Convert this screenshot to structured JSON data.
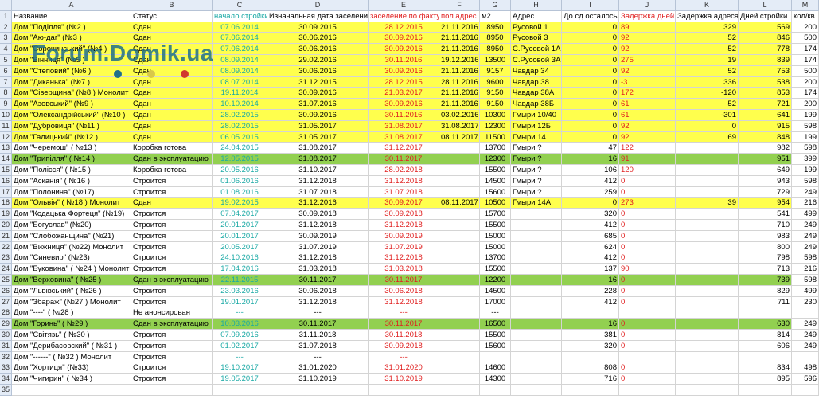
{
  "column_letters": [
    "A",
    "B",
    "C",
    "D",
    "E",
    "F",
    "G",
    "H",
    "I",
    "J",
    "K",
    "L",
    "M"
  ],
  "header": [
    "Название",
    "Статус",
    "начало стройки",
    "Изначальная дата заселения",
    "заселение по факту",
    "пол.адрес",
    "м2",
    "Адрес",
    "До сд.осталось",
    "Задержка дней",
    "Задержка адреса",
    "Дней стройки",
    "кол/кв"
  ],
  "watermark": "Forum.Domik.ua",
  "colors": {
    "yellow": "#ffff4d",
    "green": "#92d050",
    "teal": "#1aa9a5",
    "red": "#e02020"
  },
  "rows": [
    {
      "n": "2",
      "hl": "yellow",
      "c": [
        "Дом \"Поділля\" (№2 )",
        "Сдан",
        "07.06.2014",
        "30.09.2015",
        "28.12.2015",
        "21.11.2016",
        "8950",
        "Русовой 1",
        "0",
        "89",
        "329",
        "569",
        "200"
      ]
    },
    {
      "n": "3",
      "hl": "yellow",
      "c": [
        "Дом \"Аю-даг\" (№3 )",
        "Сдан",
        "07.06.2014",
        "30.06.2016",
        "30.09.2016",
        "21.11.2016",
        "8950",
        "Русовой 3",
        "0",
        "92",
        "52",
        "846",
        "500"
      ]
    },
    {
      "n": "4",
      "hl": "yellow",
      "c": [
        "Дом \"Сорочинський\" (№4 )",
        "Сдан",
        "07.06.2014",
        "30.06.2016",
        "30.09.2016",
        "21.11.2016",
        "8950",
        "С.Русовой 1А",
        "0",
        "92",
        "52",
        "778",
        "174"
      ]
    },
    {
      "n": "5",
      "hl": "yellow",
      "c": [
        "Дом \"Вінниця\" (№5 )",
        "Сдан",
        "08.09.2014",
        "29.02.2016",
        "30.11.2016",
        "19.12.2016",
        "13500",
        "С.Русовой 3А",
        "0",
        "275",
        "19",
        "839",
        "174"
      ]
    },
    {
      "n": "6",
      "hl": "yellow",
      "c": [
        "Дом \"Степовий\" (№6 )",
        "Сдан",
        "08.09.2014",
        "30.06.2016",
        "30.09.2016",
        "21.11.2016",
        "9157",
        "Чавдар 34",
        "0",
        "92",
        "52",
        "753",
        "500"
      ]
    },
    {
      "n": "7",
      "hl": "yellow",
      "c": [
        "Дом \"Диканька\" (№7 )",
        "Сдан",
        "08.07.2014",
        "31.12.2015",
        "28.12.2015",
        "28.11.2016",
        "9600",
        "Чавдар 38",
        "0",
        "-3",
        "336",
        "538",
        "200"
      ]
    },
    {
      "n": "8",
      "hl": "yellow",
      "c": [
        "Дом \"Сіверщина\" (№8 ) Монолит",
        "Сдан",
        "19.11.2014",
        "30.09.2016",
        "21.03.2017",
        "21.11.2016",
        "9150",
        "Чавдар 38А",
        "0",
        "172",
        "-120",
        "853",
        "174"
      ]
    },
    {
      "n": "9",
      "hl": "yellow",
      "c": [
        "Дом \"Азовський\" (№9 )",
        "Сдан",
        "10.10.2014",
        "31.07.2016",
        "30.09.2016",
        "21.11.2016",
        "9150",
        "Чавдар 38Б",
        "0",
        "61",
        "52",
        "721",
        "200"
      ]
    },
    {
      "n": "10",
      "hl": "yellow",
      "c": [
        "Дом \"Олександрійський\" (№10 )",
        "Сдан",
        "28.02.2015",
        "30.09.2016",
        "30.11.2016",
        "03.02.2016",
        "10300",
        "Гмыри 10/40",
        "0",
        "61",
        "-301",
        "641",
        "199"
      ]
    },
    {
      "n": "11",
      "hl": "yellow",
      "c": [
        "Дом \"Дубровиця\" (№11 )",
        "Сдан",
        "28.02.2015",
        "31.05.2017",
        "31.08.2017",
        "31.08.2017",
        "12300",
        "Гмыри 12Б",
        "0",
        "92",
        "0",
        "915",
        "598"
      ]
    },
    {
      "n": "12",
      "hl": "yellow",
      "c": [
        "Дом \"Галицький\" (№12 )",
        "Сдан",
        "06.05.2015",
        "31.05.2017",
        "31.08.2017",
        "08.11.2017",
        "11500",
        "Гмыри 14",
        "0",
        "92",
        "69",
        "848",
        "199"
      ]
    },
    {
      "n": "13",
      "hl": "",
      "c": [
        "Дом \"Черемош\" ( №13 )",
        "Коробка готова",
        "24.04.2015",
        "31.08.2017",
        "31.12.2017",
        "",
        "13700",
        "Гмыри ?",
        "47",
        "122",
        "",
        "982",
        "598"
      ]
    },
    {
      "n": "14",
      "hl": "green",
      "c": [
        "Дом \"Трипілля\" ( №14 )",
        "Сдан в эксплуатацию",
        "12.05.2015",
        "31.08.2017",
        "30.11.2017",
        "",
        "12300",
        "Гмыри ?",
        "16",
        "91",
        "",
        "951",
        "399"
      ]
    },
    {
      "n": "15",
      "hl": "",
      "c": [
        "Дом \"Полісся\" ( №15 )",
        "Коробка готова",
        "20.05.2016",
        "31.10.2017",
        "28.02.2018",
        "",
        "15500",
        "Гмыри ?",
        "106",
        "120",
        "",
        "649",
        "199"
      ]
    },
    {
      "n": "16",
      "hl": "",
      "c": [
        "Дом \"Асканія\" ( №16 )",
        "Строится",
        "01.06.2016",
        "31.12.2018",
        "31.12.2018",
        "",
        "14500",
        "Гмыри ?",
        "412",
        "0",
        "",
        "943",
        "598"
      ]
    },
    {
      "n": "17",
      "hl": "",
      "c": [
        "Дом \"Полонина\" (№17)",
        "Строится",
        "01.08.2016",
        "31.07.2018",
        "31.07.2018",
        "",
        "15600",
        "Гмыри ?",
        "259",
        "0",
        "",
        "729",
        "249"
      ]
    },
    {
      "n": "18",
      "hl": "yellow",
      "c": [
        "Дом \"Ольвія\" ( №18 ) Монолит",
        "Сдан",
        "19.02.2015",
        "31.12.2016",
        "30.09.2017",
        "08.11.2017",
        "10500",
        "Гмыри 14А",
        "0",
        "273",
        "39",
        "954",
        "216"
      ]
    },
    {
      "n": "19",
      "hl": "",
      "c": [
        "Дом \"Кодацька Фортеця\" (№19)",
        "Строится",
        "07.04.2017",
        "30.09.2018",
        "30.09.2018",
        "",
        "15700",
        "",
        "320",
        "0",
        "",
        "541",
        "499"
      ]
    },
    {
      "n": "20",
      "hl": "",
      "c": [
        "Дом \"Богуслав\" (№20)",
        "Строится",
        "20.01.2017",
        "31.12.2018",
        "31.12.2018",
        "",
        "15500",
        "",
        "412",
        "0",
        "",
        "710",
        "249"
      ]
    },
    {
      "n": "21",
      "hl": "",
      "c": [
        "Дом \"Слобожанщина\" (№21)",
        "Строится",
        "20.01.2017",
        "30.09.2019",
        "30.09.2019",
        "",
        "15000",
        "",
        "685",
        "0",
        "",
        "983",
        "249"
      ]
    },
    {
      "n": "22",
      "hl": "",
      "c": [
        "Дом \"Вижниця\" (№22) Монолит",
        "Строится",
        "20.05.2017",
        "31.07.2019",
        "31.07.2019",
        "",
        "15000",
        "",
        "624",
        "0",
        "",
        "800",
        "249"
      ]
    },
    {
      "n": "23",
      "hl": "",
      "c": [
        "Дом \"Синевир\" (№23)",
        "Строится",
        "24.10.2016",
        "31.12.2018",
        "31.12.2018",
        "",
        "13700",
        "",
        "412",
        "0",
        "",
        "798",
        "598"
      ]
    },
    {
      "n": "24",
      "hl": "",
      "c": [
        "Дом \"Буковина\" ( №24 ) Монолит",
        "Строится",
        "17.04.2016",
        "31.03.2018",
        "31.03.2018",
        "",
        "15500",
        "",
        "137",
        "90",
        "",
        "713",
        "216"
      ]
    },
    {
      "n": "25",
      "hl": "green",
      "c": [
        "Дом \"Верховина\" ( №25 )",
        "Сдан в эксплуатацию",
        "22.11.2015",
        "30.11.2017",
        "30.11.2017",
        "",
        "12200",
        "",
        "16",
        "0",
        "",
        "739",
        "598"
      ]
    },
    {
      "n": "26",
      "hl": "",
      "c": [
        "Дом \"Львівський\" ( №26 )",
        "Строится",
        "23.03.2016",
        "30.06.2018",
        "30.06.2018",
        "",
        "14500",
        "",
        "228",
        "0",
        "",
        "829",
        "499"
      ]
    },
    {
      "n": "27",
      "hl": "",
      "c": [
        "Дом \"Збараж\" (№27 ) Монолит",
        "Строится",
        "19.01.2017",
        "31.12.2018",
        "31.12.2018",
        "",
        "17000",
        "",
        "412",
        "0",
        "",
        "711",
        "230"
      ]
    },
    {
      "n": "28",
      "hl": "",
      "c": [
        "Дом \"----\" ( №28 )",
        "Не анонсирован",
        "---",
        "---",
        "---",
        "",
        "---",
        "",
        "",
        "",
        "",
        "",
        ""
      ]
    },
    {
      "n": "29",
      "hl": "green",
      "c": [
        "Дом \"Горинь\" ( №29 )",
        "Сдан в эксплуатацию",
        "10.03.2016",
        "30.11.2017",
        "30.11.2017",
        "",
        "16500",
        "",
        "16",
        "0",
        "",
        "630",
        "249"
      ]
    },
    {
      "n": "30",
      "hl": "",
      "c": [
        "Дом \"Світязь\" ( №30 )",
        "Строится",
        "07.09.2016",
        "31.11.2018",
        "30.11.2018",
        "",
        "15500",
        "",
        "381",
        "0",
        "",
        "814",
        "249"
      ]
    },
    {
      "n": "31",
      "hl": "",
      "c": [
        "Дом \"Дерибасовский\" ( №31 )",
        "Строится",
        "01.02.2017",
        "31.07.2018",
        "30.09.2018",
        "",
        "15600",
        "",
        "320",
        "0",
        "",
        "606",
        "249"
      ]
    },
    {
      "n": "32",
      "hl": "",
      "c": [
        "Дом \"------\" ( №32 ) Монолит",
        "Строится",
        "---",
        "---",
        "---",
        "",
        "",
        "",
        "",
        "",
        "",
        "",
        ""
      ]
    },
    {
      "n": "33",
      "hl": "",
      "c": [
        "Дом \"Хортиця\" (№33)",
        "Строится",
        "19.10.2017",
        "31.01.2020",
        "31.01.2020",
        "",
        "14600",
        "",
        "808",
        "0",
        "",
        "834",
        "498"
      ]
    },
    {
      "n": "34",
      "hl": "",
      "c": [
        "Дом \"Чигирин\" ( №34 )",
        "Строится",
        "19.05.2017",
        "31.10.2019",
        "31.10.2019",
        "",
        "14300",
        "",
        "716",
        "0",
        "",
        "895",
        "596"
      ]
    },
    {
      "n": "35",
      "hl": "",
      "c": [
        "",
        "",
        "",
        "",
        "",
        "",
        "",
        "",
        "",
        "",
        "",
        "",
        ""
      ]
    }
  ]
}
